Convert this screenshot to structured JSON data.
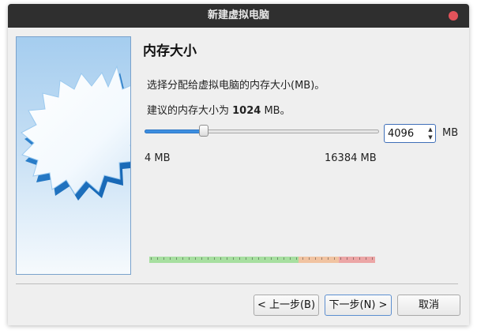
{
  "window": {
    "title": "新建虚拟电脑"
  },
  "page": {
    "heading": "内存大小",
    "description": "选择分配给虚拟电脑的内存大小(MB)。",
    "recommend_prefix": "建议的内存大小为 ",
    "recommend_value": "1024",
    "recommend_suffix": " MB。"
  },
  "memory": {
    "value": "4096",
    "unit": "MB",
    "min_label": "4 MB",
    "max_label": "16384 MB",
    "slider_min": 4,
    "slider_max": 16384,
    "slider_value": 4096,
    "zones": [
      {
        "name": "safe",
        "color": "#a7dfa0",
        "start": 0,
        "end": 0.66
      },
      {
        "name": "warning",
        "color": "#f1c3a1",
        "start": 0.66,
        "end": 0.84
      },
      {
        "name": "danger",
        "color": "#eca6a6",
        "start": 0.84,
        "end": 1
      }
    ]
  },
  "buttons": {
    "back": "< 上一步(B)",
    "next": "下一步(N) >",
    "cancel": "取消"
  },
  "colors": {
    "titlebar": "#2f2f2f",
    "close": "#e2535a",
    "accent": "#3c8ee0"
  },
  "icons": {
    "close": "close-icon",
    "spin_up": "chevron-up-icon",
    "spin_down": "chevron-down-icon",
    "wizard_art": "starburst-illustration"
  }
}
